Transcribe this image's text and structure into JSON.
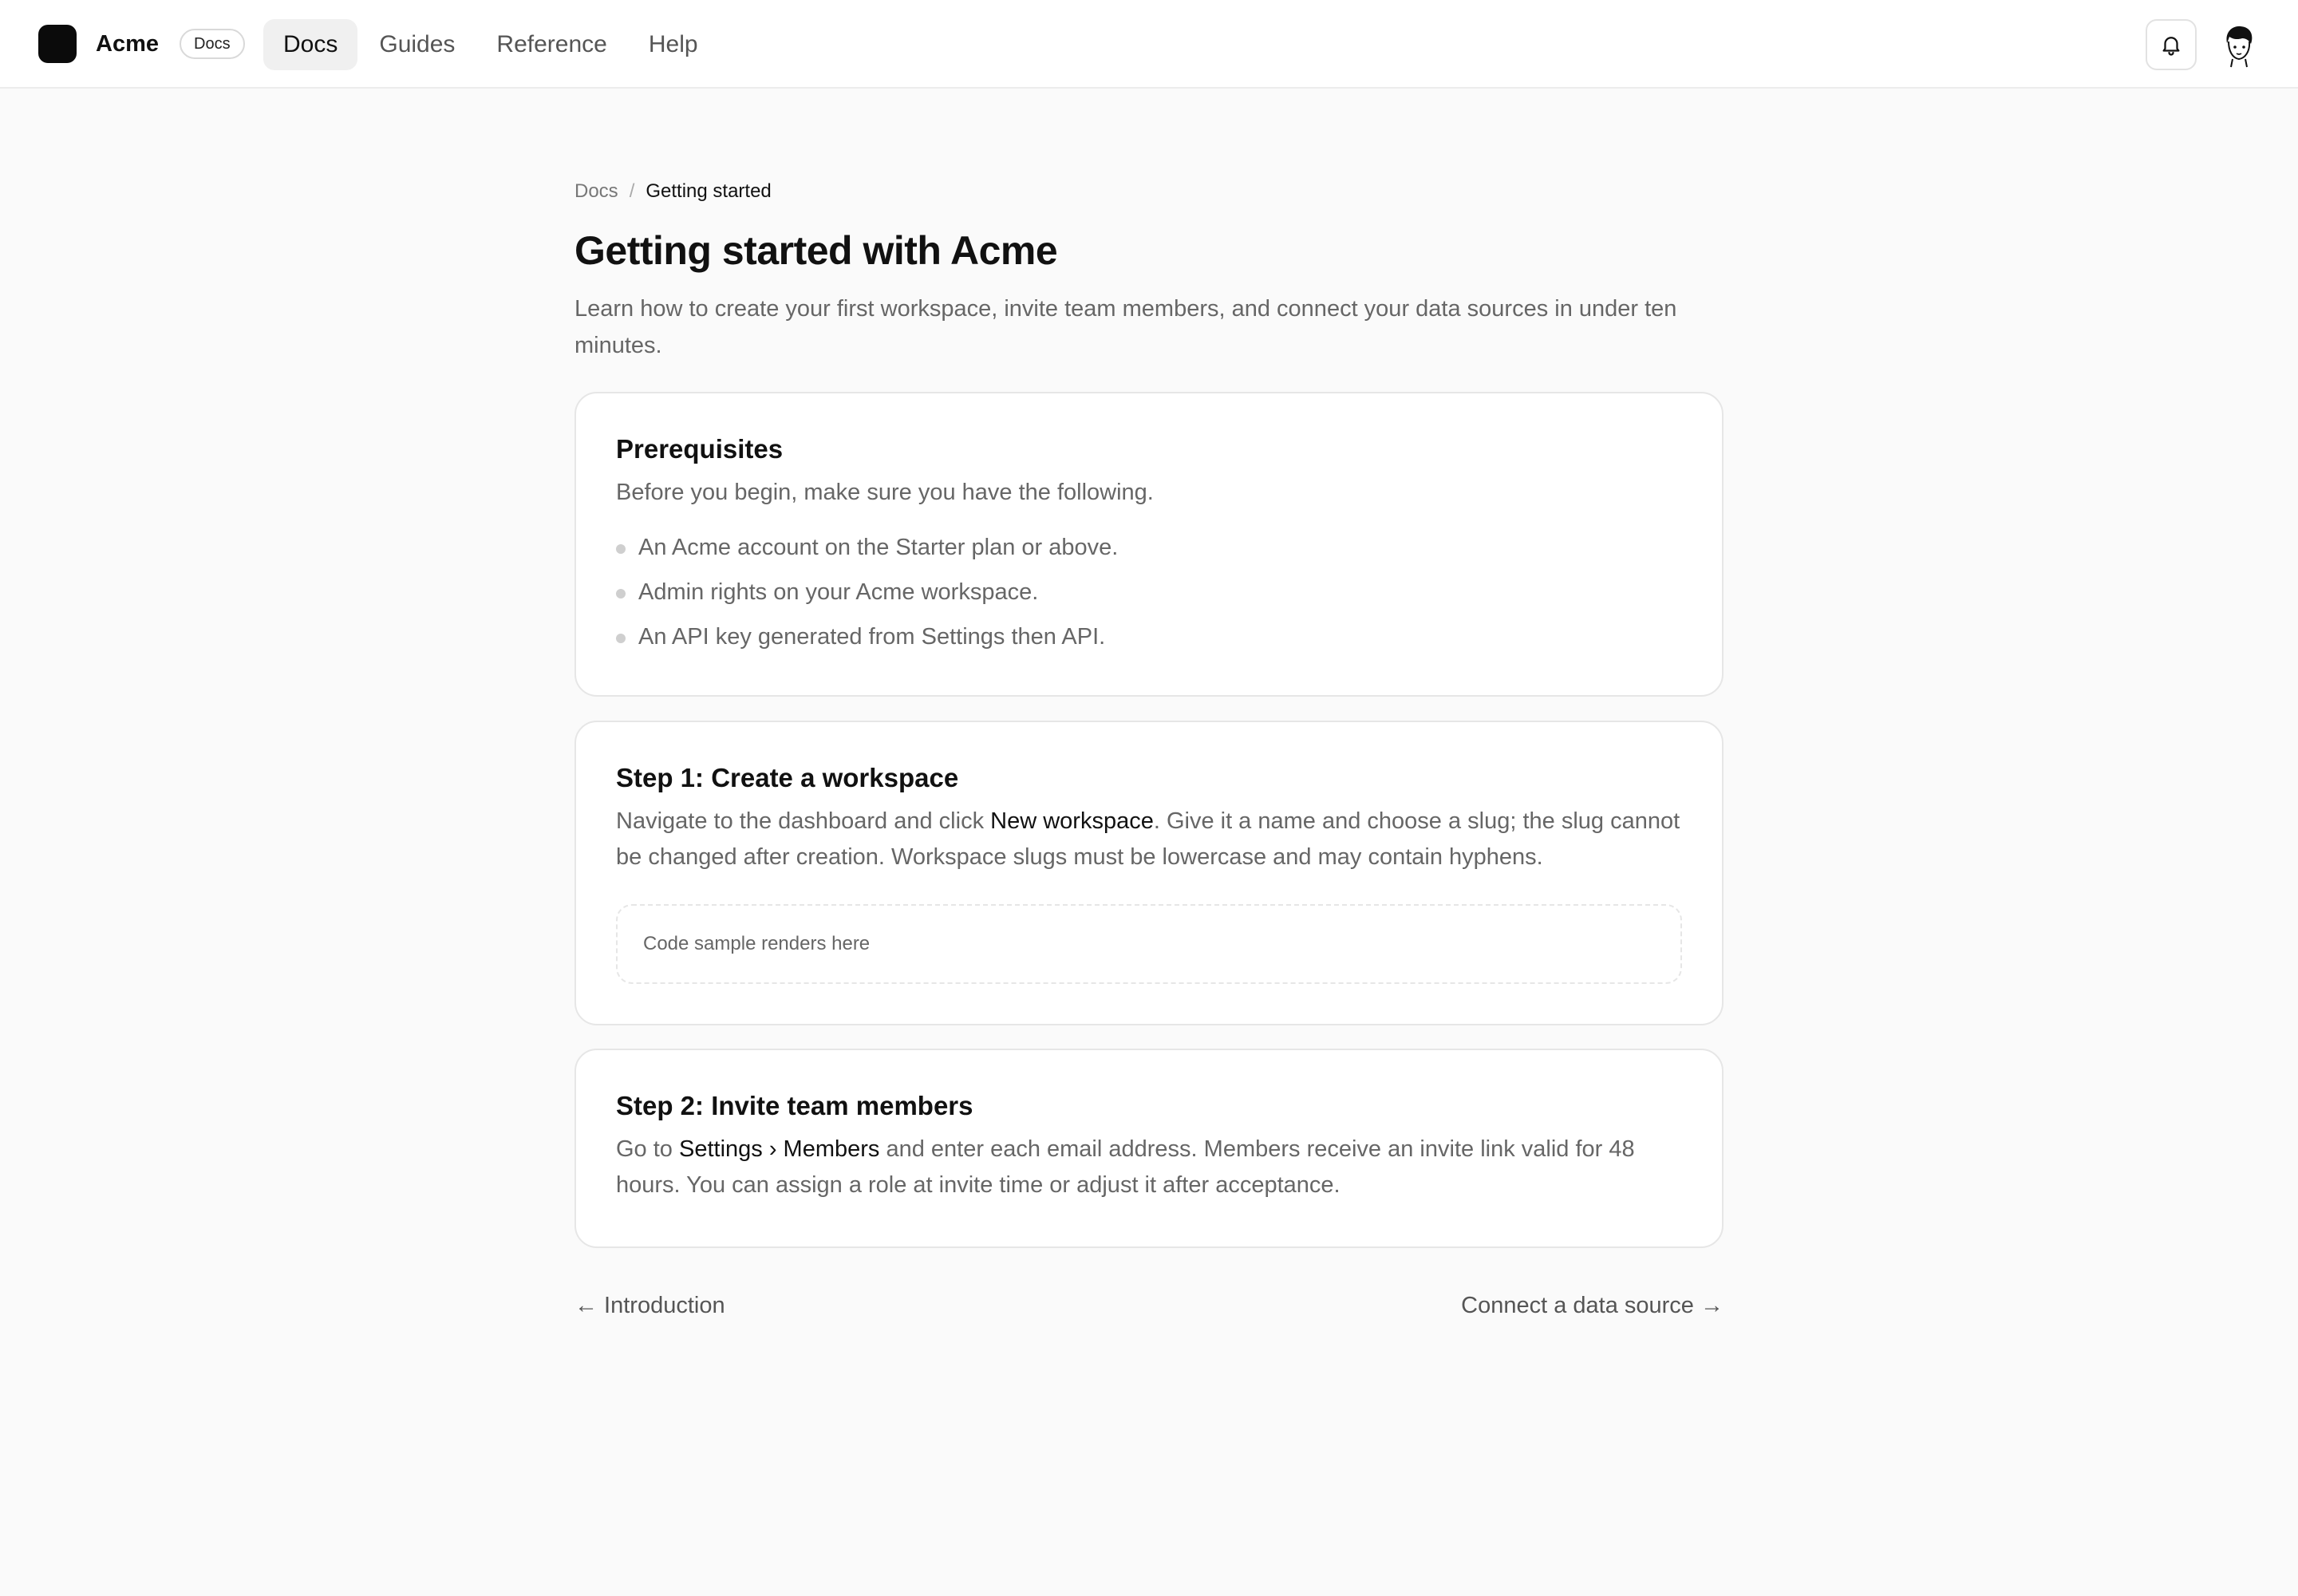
{
  "header": {
    "brand_name": "Acme",
    "brand_badge": "Docs",
    "nav": [
      {
        "label": "Docs",
        "active": true
      },
      {
        "label": "Guides"
      },
      {
        "label": "Reference"
      },
      {
        "label": "Help"
      }
    ],
    "icons": {
      "notifications": "bell-icon",
      "avatar": "user-avatar"
    }
  },
  "breadcrumb": {
    "root": "Docs",
    "separator": "/",
    "current": "Getting started"
  },
  "page": {
    "title": "Getting started with Acme",
    "lead": "Learn how to create your first workspace, invite team members, and connect your data sources in under ten minutes."
  },
  "prerequisites": {
    "title": "Prerequisites",
    "intro": "Before you begin, make sure you have the following.",
    "items": [
      "An Acme account on the Starter plan or above.",
      "Admin rights on your Acme workspace.",
      "An API key generated from Settings then API."
    ]
  },
  "step1": {
    "title": "Step 1: Create a workspace",
    "text_before": "Navigate to the dashboard and click ",
    "highlight": "New workspace",
    "text_after": ". Give it a name and choose a slug; the slug cannot be changed after creation. Workspace slugs must be lowercase and may contain hyphens.",
    "code_placeholder": "Code sample renders here"
  },
  "step2": {
    "title": "Step 2: Invite team members",
    "text_before": "Go to ",
    "highlight": "Settings › Members",
    "text_after": " and enter each email address. Members receive an invite link valid for 48 hours. You can assign a role at invite time or adjust it after acceptance."
  },
  "pager": {
    "prev": "← Introduction",
    "next": "Connect a data source →"
  },
  "colors": {
    "background": "#fafafa",
    "card": "#ffffff",
    "text": "#111111",
    "muted": "#666666",
    "logo": "#0b0b0b"
  }
}
